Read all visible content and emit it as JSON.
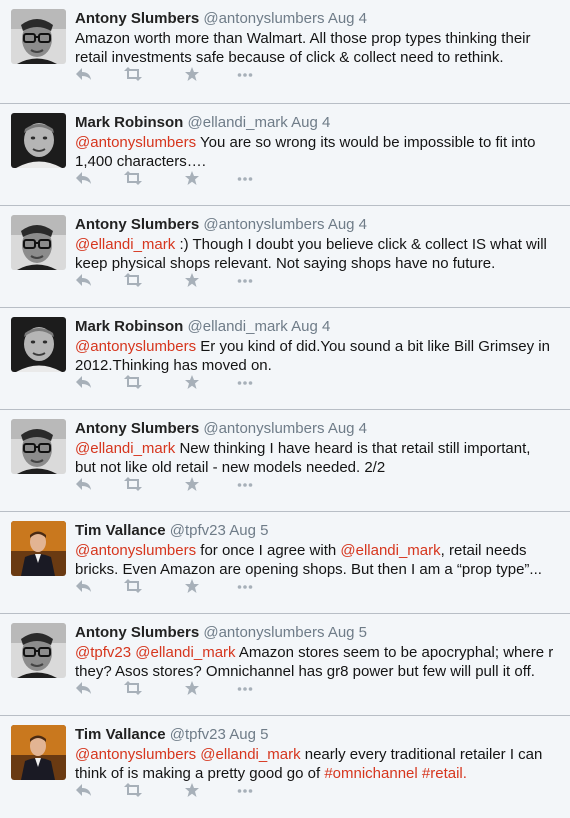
{
  "tweets": [
    {
      "avatar": "avatar-antony",
      "name": "Antony Slumbers",
      "handle": "@antonyslumbers",
      "date": "Aug 4",
      "parts": [
        {
          "t": "text",
          "v": "Amazon worth more than Walmart. All those prop types thinking their retail investments safe because of click & collect need to rethink."
        }
      ]
    },
    {
      "avatar": "avatar-mark",
      "name": "Mark Robinson",
      "handle": "@ellandi_mark",
      "date": "Aug 4",
      "parts": [
        {
          "t": "mention",
          "v": "@antonyslumbers"
        },
        {
          "t": "text",
          "v": " You are so wrong its would be impossible to fit into 1,400 characters…."
        }
      ]
    },
    {
      "avatar": "avatar-antony",
      "name": "Antony Slumbers",
      "handle": "@antonyslumbers",
      "date": "Aug 4",
      "parts": [
        {
          "t": "mention",
          "v": "@ellandi_mark"
        },
        {
          "t": "text",
          "v": " :) Though I doubt you believe click & collect IS what will keep physical shops relevant. Not saying shops have no future."
        }
      ]
    },
    {
      "avatar": "avatar-mark",
      "name": "Mark Robinson",
      "handle": "@ellandi_mark",
      "date": "Aug 4",
      "parts": [
        {
          "t": "mention",
          "v": "@antonyslumbers"
        },
        {
          "t": "text",
          "v": " Er you kind of did.You sound a bit like Bill Grimsey in 2012.Thinking has moved on."
        }
      ]
    },
    {
      "avatar": "avatar-antony",
      "name": "Antony Slumbers",
      "handle": "@antonyslumbers",
      "date": "Aug 4",
      "parts": [
        {
          "t": "mention",
          "v": "@ellandi_mark"
        },
        {
          "t": "text",
          "v": " New thinking I have heard is that retail still important, but not like old retail - new models needed. 2/2"
        }
      ]
    },
    {
      "avatar": "avatar-tim",
      "name": "Tim Vallance",
      "handle": "@tpfv23",
      "date": "Aug 5",
      "parts": [
        {
          "t": "mention",
          "v": "@antonyslumbers"
        },
        {
          "t": "text",
          "v": " for once I agree with "
        },
        {
          "t": "mention",
          "v": "@ellandi_mark"
        },
        {
          "t": "text",
          "v": ", retail needs bricks. Even Amazon are opening shops. But then I am a “prop type”..."
        }
      ]
    },
    {
      "avatar": "avatar-antony",
      "name": "Antony Slumbers",
      "handle": "@antonyslumbers",
      "date": "Aug 5",
      "parts": [
        {
          "t": "mention",
          "v": "@tpfv23"
        },
        {
          "t": "text",
          "v": " "
        },
        {
          "t": "mention",
          "v": "@ellandi_mark"
        },
        {
          "t": "text",
          "v": " Amazon stores seem to be apocryphal; where r they? Asos stores? Omnichannel has gr8 power but few will pull it off."
        }
      ]
    },
    {
      "avatar": "avatar-tim",
      "name": "Tim Vallance",
      "handle": "@tpfv23",
      "date": "Aug 5",
      "parts": [
        {
          "t": "mention",
          "v": "@antonyslumbers"
        },
        {
          "t": "text",
          "v": " "
        },
        {
          "t": "mention",
          "v": "@ellandi_mark"
        },
        {
          "t": "text",
          "v": " nearly every traditional retailer I can think of is making a pretty good go of "
        },
        {
          "t": "tag",
          "v": "#omnichannel"
        },
        {
          "t": "text",
          "v": " "
        },
        {
          "t": "tag",
          "v": "#retail."
        }
      ]
    }
  ],
  "actions": [
    "reply-icon",
    "retweet-icon",
    "favorite-icon",
    "more-icon"
  ],
  "colors": {
    "background": "#e3e7ec",
    "card": "#f3f6f9",
    "link": "#d6361e",
    "meta": "#6f7c88",
    "icon": "#a7b0b9"
  }
}
